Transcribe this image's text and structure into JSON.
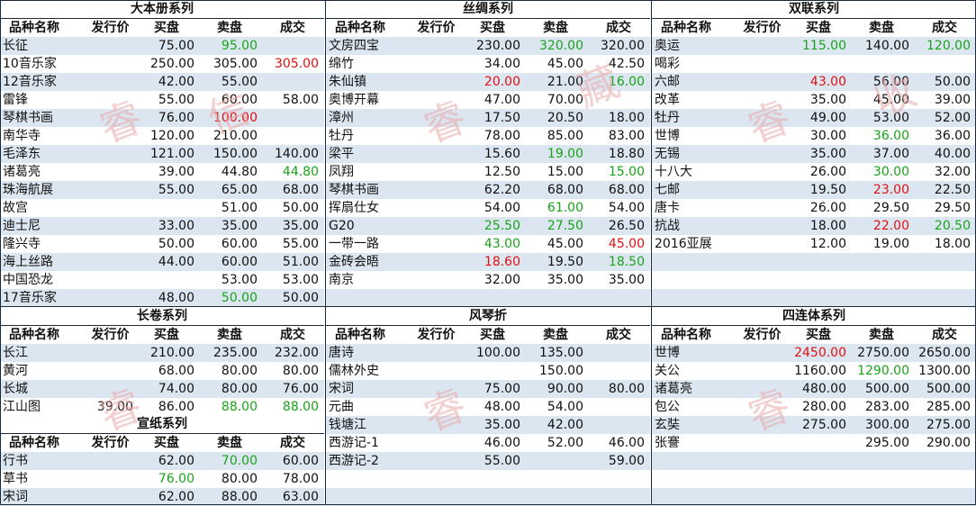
{
  "colors": {
    "alt_row": "#dce6f1",
    "green": "#19a319",
    "red": "#e01010",
    "border": "#1b2a3a"
  },
  "headers": {
    "name": "品种名称",
    "issue": "发行价",
    "buy": "买盘",
    "sell": "卖盘",
    "deal": "成交"
  },
  "panels": [
    {
      "id": "dabence",
      "title": "大本册系列",
      "rows": [
        {
          "name": "长征",
          "issue": "",
          "buy": "75.00",
          "sell": "95.00",
          "deal": "",
          "sell_color": "green"
        },
        {
          "name": "10音乐家",
          "issue": "",
          "buy": "250.00",
          "sell": "305.00",
          "deal": "305.00",
          "deal_color": "red"
        },
        {
          "name": "12音乐家",
          "issue": "",
          "buy": "42.00",
          "sell": "55.00",
          "deal": ""
        },
        {
          "name": "雷锋",
          "issue": "",
          "buy": "55.00",
          "sell": "60.00",
          "deal": "58.00"
        },
        {
          "name": "琴棋书画",
          "issue": "",
          "buy": "76.00",
          "sell": "100.00",
          "deal": "",
          "sell_color": "red"
        },
        {
          "name": "南华寺",
          "issue": "",
          "buy": "120.00",
          "sell": "210.00",
          "deal": ""
        },
        {
          "name": "毛泽东",
          "issue": "",
          "buy": "121.00",
          "sell": "150.00",
          "deal": "140.00"
        },
        {
          "name": "诸葛亮",
          "issue": "",
          "buy": "39.00",
          "sell": "44.80",
          "deal": "44.80",
          "deal_color": "green"
        },
        {
          "name": "珠海航展",
          "issue": "",
          "buy": "55.00",
          "sell": "65.00",
          "deal": "68.00"
        },
        {
          "name": "故宫",
          "issue": "",
          "buy": "",
          "sell": "51.00",
          "deal": "50.00"
        },
        {
          "name": "迪士尼",
          "issue": "",
          "buy": "33.00",
          "sell": "35.00",
          "deal": "35.00"
        },
        {
          "name": "隆兴寺",
          "issue": "",
          "buy": "50.00",
          "sell": "60.00",
          "deal": "55.00"
        },
        {
          "name": "海上丝路",
          "issue": "",
          "buy": "44.00",
          "sell": "60.00",
          "deal": "51.00"
        },
        {
          "name": "中国恐龙",
          "issue": "",
          "buy": "",
          "sell": "53.00",
          "deal": "53.00"
        },
        {
          "name": "17音乐家",
          "issue": "",
          "buy": "48.00",
          "sell": "50.00",
          "deal": "50.00",
          "sell_color": "green"
        }
      ]
    },
    {
      "id": "sichou",
      "title": "丝绸系列",
      "rows": [
        {
          "name": "文房四宝",
          "issue": "",
          "buy": "230.00",
          "sell": "320.00",
          "deal": "320.00",
          "sell_color": "green"
        },
        {
          "name": "绵竹",
          "issue": "",
          "buy": "34.00",
          "sell": "45.00",
          "deal": "42.50"
        },
        {
          "name": "朱仙镇",
          "issue": "",
          "buy": "20.00",
          "sell": "21.00",
          "deal": "16.00",
          "buy_color": "red",
          "deal_color": "green"
        },
        {
          "name": "奥博开幕",
          "issue": "",
          "buy": "47.00",
          "sell": "70.00",
          "deal": ""
        },
        {
          "name": "漳州",
          "issue": "",
          "buy": "17.50",
          "sell": "20.50",
          "deal": "18.00"
        },
        {
          "name": "牡丹",
          "issue": "",
          "buy": "78.00",
          "sell": "85.00",
          "deal": "83.00"
        },
        {
          "name": "梁平",
          "issue": "",
          "buy": "15.60",
          "sell": "19.00",
          "deal": "18.80",
          "sell_color": "green"
        },
        {
          "name": "凤翔",
          "issue": "",
          "buy": "12.50",
          "sell": "15.00",
          "deal": "15.00",
          "deal_color": "green"
        },
        {
          "name": "琴棋书画",
          "issue": "",
          "buy": "62.20",
          "sell": "68.00",
          "deal": "68.00"
        },
        {
          "name": "挥扇仕女",
          "issue": "",
          "buy": "54.00",
          "sell": "61.00",
          "deal": "54.00",
          "sell_color": "green"
        },
        {
          "name": "G20",
          "issue": "",
          "buy": "25.50",
          "sell": "27.50",
          "deal": "26.50",
          "buy_color": "green",
          "sell_color": "green"
        },
        {
          "name": "一带一路",
          "issue": "",
          "buy": "43.00",
          "sell": "45.00",
          "deal": "45.00",
          "buy_color": "green",
          "deal_color": "red"
        },
        {
          "name": "金砖会晤",
          "issue": "",
          "buy": "18.60",
          "sell": "19.50",
          "deal": "18.50",
          "buy_color": "red",
          "deal_color": "green"
        },
        {
          "name": "南京",
          "issue": "",
          "buy": "32.00",
          "sell": "35.00",
          "deal": "35.00"
        },
        {
          "name": "",
          "issue": "",
          "buy": "",
          "sell": "",
          "deal": ""
        }
      ]
    },
    {
      "id": "shuanglian",
      "title": "双联系列",
      "rows": [
        {
          "name": "奥运",
          "issue": "",
          "buy": "115.00",
          "sell": "140.00",
          "deal": "120.00",
          "buy_color": "green",
          "deal_color": "green"
        },
        {
          "name": "喝彩",
          "issue": "",
          "buy": "",
          "sell": "",
          "deal": ""
        },
        {
          "name": "六邮",
          "issue": "",
          "buy": "43.00",
          "sell": "56.00",
          "deal": "50.00",
          "buy_color": "red"
        },
        {
          "name": "改革",
          "issue": "",
          "buy": "35.00",
          "sell": "45.00",
          "deal": "39.00"
        },
        {
          "name": "牡丹",
          "issue": "",
          "buy": "49.00",
          "sell": "53.00",
          "deal": "52.00"
        },
        {
          "name": "世博",
          "issue": "",
          "buy": "30.00",
          "sell": "36.00",
          "deal": "36.00",
          "sell_color": "green"
        },
        {
          "name": "无锡",
          "issue": "",
          "buy": "35.00",
          "sell": "37.00",
          "deal": "40.00"
        },
        {
          "name": "十八大",
          "issue": "",
          "buy": "26.00",
          "sell": "30.00",
          "deal": "32.00",
          "sell_color": "green"
        },
        {
          "name": "七邮",
          "issue": "",
          "buy": "19.50",
          "sell": "23.00",
          "deal": "22.50",
          "sell_color": "red"
        },
        {
          "name": "唐卡",
          "issue": "",
          "buy": "26.00",
          "sell": "29.50",
          "deal": "29.50"
        },
        {
          "name": "抗战",
          "issue": "",
          "buy": "18.00",
          "sell": "22.00",
          "deal": "20.50",
          "sell_color": "red",
          "deal_color": "green"
        },
        {
          "name": "2016亚展",
          "issue": "",
          "buy": "12.00",
          "sell": "19.00",
          "deal": "18.00"
        },
        {
          "name": "",
          "issue": "",
          "buy": "",
          "sell": "",
          "deal": ""
        },
        {
          "name": "",
          "issue": "",
          "buy": "",
          "sell": "",
          "deal": ""
        },
        {
          "name": "",
          "issue": "",
          "buy": "",
          "sell": "",
          "deal": ""
        }
      ]
    },
    {
      "id": "changjuan",
      "title": "长卷系列",
      "rows": [
        {
          "name": "长江",
          "issue": "",
          "buy": "210.00",
          "sell": "235.00",
          "deal": "232.00"
        },
        {
          "name": "黄河",
          "issue": "",
          "buy": "68.00",
          "sell": "80.00",
          "deal": "80.00"
        },
        {
          "name": "长城",
          "issue": "",
          "buy": "74.00",
          "sell": "80.00",
          "deal": "76.00"
        },
        {
          "name": "江山图",
          "issue": "39.00",
          "buy": "86.00",
          "sell": "88.00",
          "deal": "88.00",
          "sell_color": "green",
          "deal_color": "green"
        }
      ]
    },
    {
      "id": "xuanzhi",
      "title": "宣纸系列",
      "rows": [
        {
          "name": "行书",
          "issue": "",
          "buy": "62.00",
          "sell": "70.00",
          "deal": "60.00",
          "sell_color": "green"
        },
        {
          "name": "草书",
          "issue": "",
          "buy": "76.00",
          "sell": "80.00",
          "deal": "78.00",
          "buy_color": "green"
        },
        {
          "name": "宋词",
          "issue": "",
          "buy": "62.00",
          "sell": "88.00",
          "deal": "63.00"
        }
      ]
    },
    {
      "id": "fengqinzhe",
      "title": "风琴折",
      "rows": [
        {
          "name": "唐诗",
          "issue": "",
          "buy": "100.00",
          "sell": "135.00",
          "deal": ""
        },
        {
          "name": "儒林外史",
          "issue": "",
          "buy": "",
          "sell": "150.00",
          "deal": ""
        },
        {
          "name": "宋词",
          "issue": "",
          "buy": "75.00",
          "sell": "90.00",
          "deal": "80.00"
        },
        {
          "name": "元曲",
          "issue": "",
          "buy": "48.00",
          "sell": "54.00",
          "deal": ""
        },
        {
          "name": "钱塘江",
          "issue": "",
          "buy": "35.00",
          "sell": "42.00",
          "deal": ""
        },
        {
          "name": "西游记-1",
          "issue": "",
          "buy": "46.00",
          "sell": "52.00",
          "deal": "46.00"
        },
        {
          "name": "西游记-2",
          "issue": "",
          "buy": "55.00",
          "sell": "",
          "deal": "59.00"
        },
        {
          "name": "",
          "issue": "",
          "buy": "",
          "sell": "",
          "deal": ""
        },
        {
          "name": "",
          "issue": "",
          "buy": "",
          "sell": "",
          "deal": ""
        }
      ]
    },
    {
      "id": "sihanti",
      "title": "四连体系列",
      "rows": [
        {
          "name": "世博",
          "issue": "",
          "buy": "2450.00",
          "sell": "2750.00",
          "deal": "2650.00",
          "buy_color": "red"
        },
        {
          "name": "关公",
          "issue": "",
          "buy": "1160.00",
          "sell": "1290.00",
          "deal": "1300.00",
          "sell_color": "green"
        },
        {
          "name": "诸葛亮",
          "issue": "",
          "buy": "480.00",
          "sell": "500.00",
          "deal": "500.00"
        },
        {
          "name": "包公",
          "issue": "",
          "buy": "280.00",
          "sell": "283.00",
          "deal": "285.00"
        },
        {
          "name": "玄奘",
          "issue": "",
          "buy": "275.00",
          "sell": "300.00",
          "deal": "275.00"
        },
        {
          "name": "张謇",
          "issue": "",
          "buy": "",
          "sell": "295.00",
          "deal": "290.00"
        },
        {
          "name": "",
          "issue": "",
          "buy": "",
          "sell": "",
          "deal": ""
        },
        {
          "name": "",
          "issue": "",
          "buy": "",
          "sell": "",
          "deal": ""
        },
        {
          "name": "",
          "issue": "",
          "buy": "",
          "sell": "",
          "deal": ""
        }
      ]
    }
  ],
  "watermark": "睿信收藏"
}
